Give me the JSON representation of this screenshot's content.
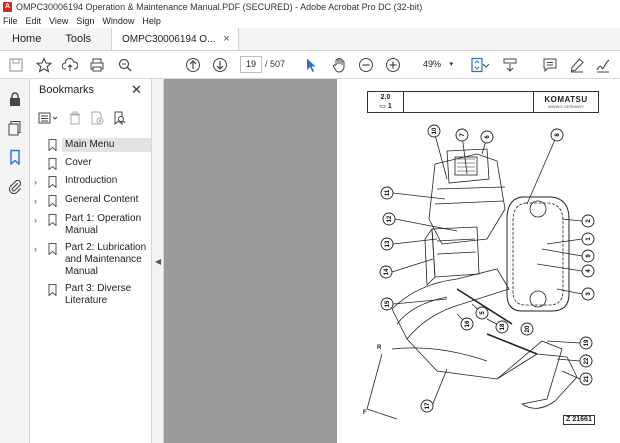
{
  "window": {
    "title": "OMPC30006194 Operation & Maintenance Manual.PDF (SECURED) - Adobe Acrobat Pro DC (32-bit)",
    "app_icon": "acrobat-icon"
  },
  "menu": [
    "File",
    "Edit",
    "View",
    "Sign",
    "Window",
    "Help"
  ],
  "tabs": {
    "home": "Home",
    "tools": "Tools",
    "document": "OMPC30006194 O...",
    "close": "×"
  },
  "toolbar": {
    "current_page": "19",
    "total_pages": "/ 507",
    "zoom": "49%",
    "zoom_dropdown": "▾"
  },
  "bookmarks": {
    "header": "Bookmarks",
    "close": "✕",
    "items": [
      {
        "label": "Main Menu",
        "expandable": false,
        "selected": true
      },
      {
        "label": "Cover",
        "expandable": false,
        "selected": false
      },
      {
        "label": "Introduction",
        "expandable": true,
        "selected": false
      },
      {
        "label": "General Content",
        "expandable": true,
        "selected": false
      },
      {
        "label": "Part 1: Operation Manual",
        "expandable": true,
        "selected": false
      },
      {
        "label": "Part 2: Lubrication and Maintenance Manual",
        "expandable": true,
        "selected": false
      },
      {
        "label": "Part 3: Diverse Literature",
        "expandable": false,
        "selected": false
      }
    ]
  },
  "page": {
    "header_num": "2.0",
    "header_sub": "1",
    "logo": "KOMATSU",
    "logo_sub": "MINING GERMANY",
    "figure_ref": "Z 21661",
    "callouts": [
      "1",
      "2",
      "3",
      "4",
      "5",
      "6",
      "7",
      "8",
      "9",
      "10",
      "11",
      "12",
      "13",
      "14",
      "15",
      "16",
      "17",
      "18",
      "19",
      "20",
      "21",
      "22"
    ]
  },
  "colors": {
    "accent_red": "#d7271c",
    "acrobat_blue": "#2b6fd6",
    "chrome_bg": "#f4f4f4",
    "doc_bg": "#9a9a9a"
  }
}
